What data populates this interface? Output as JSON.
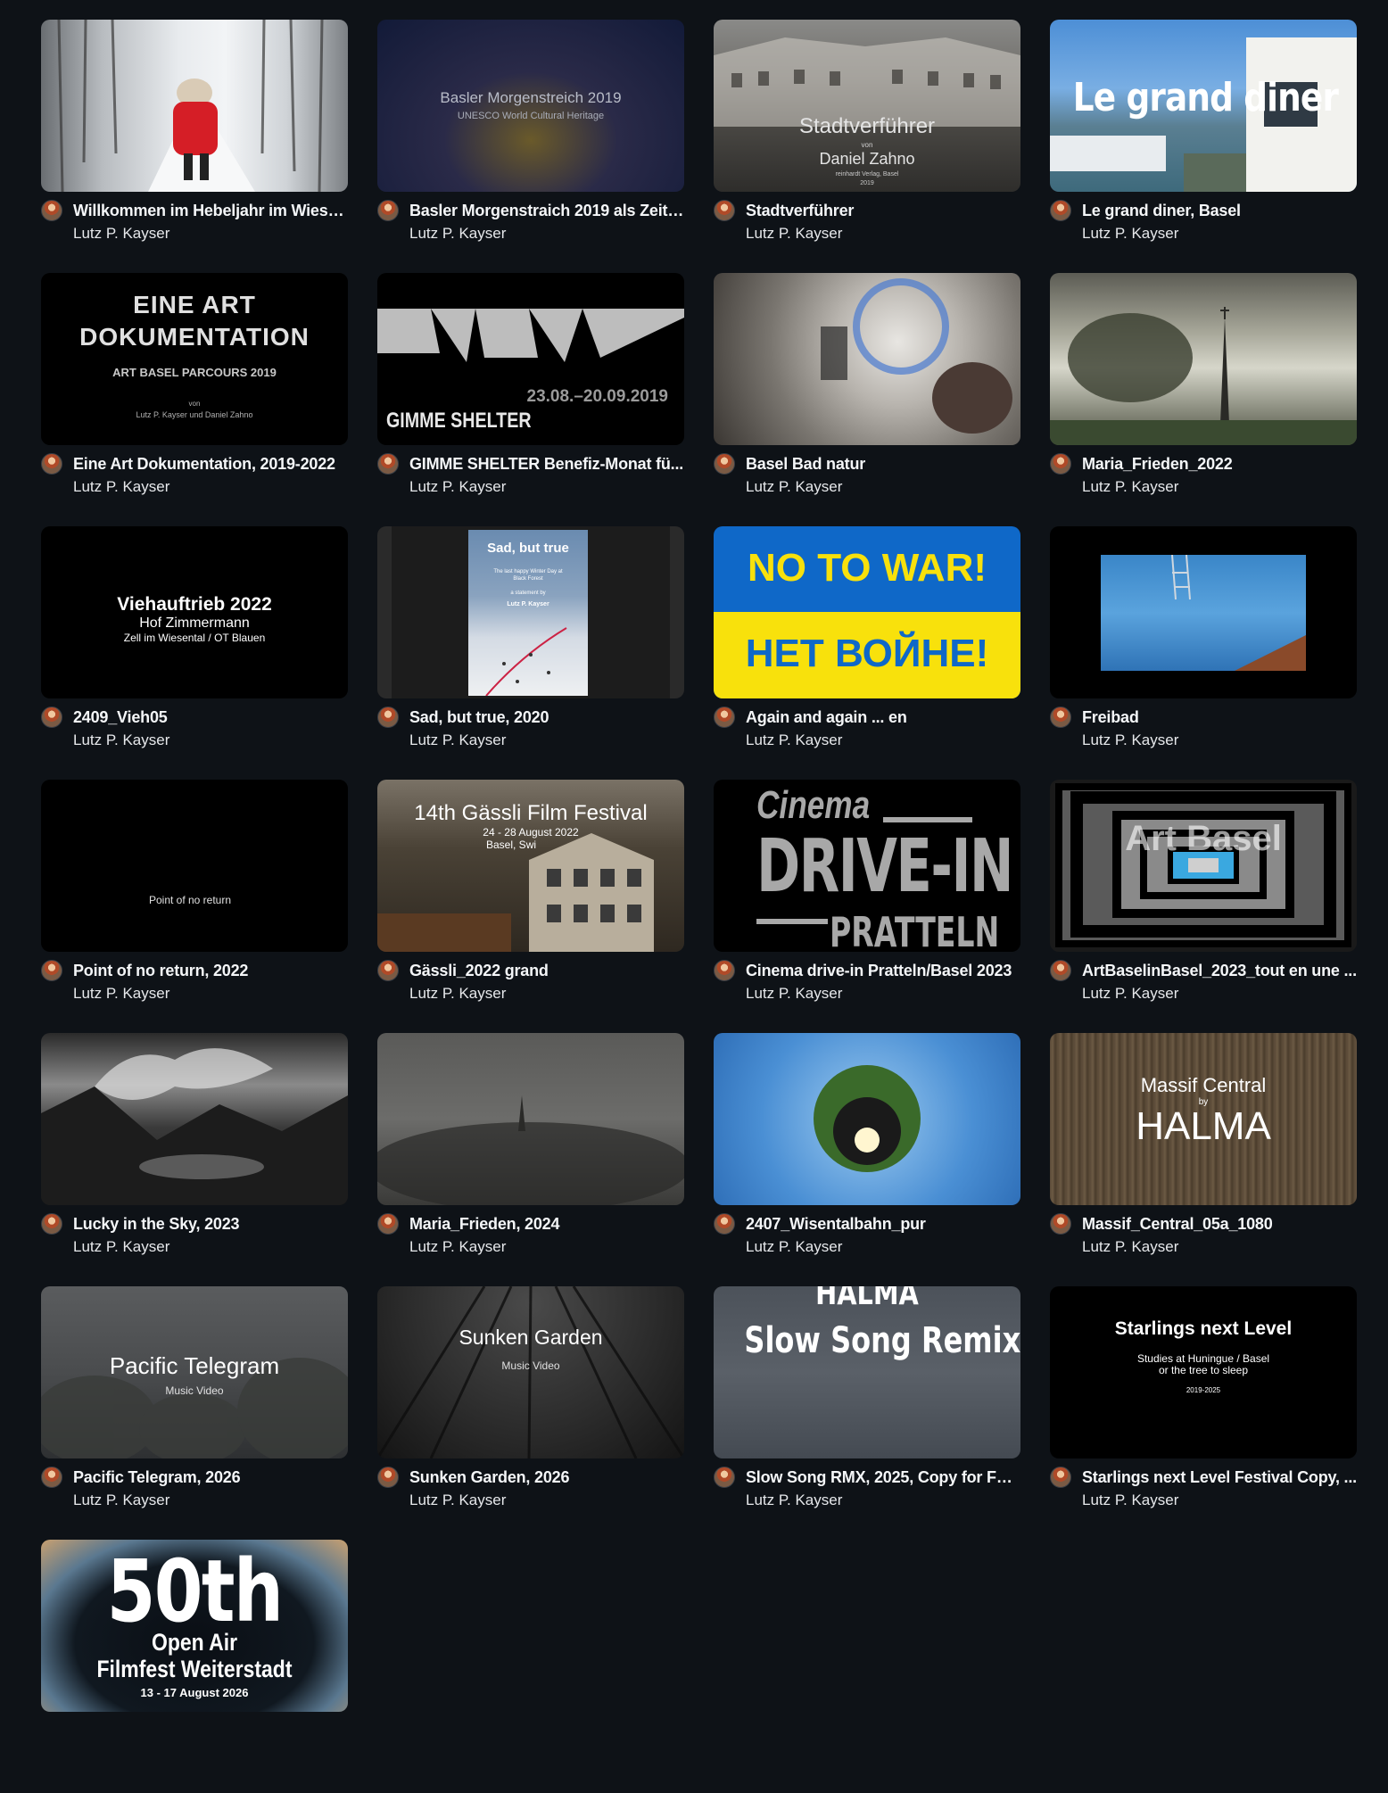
{
  "author_name": "Lutz P. Kayser",
  "videos": [
    {
      "title": "Willkommen im Hebeljahr im Wiese...",
      "author": "Lutz P. Kayser",
      "overlay": {}
    },
    {
      "title": "Basler Morgenstraich 2019 als Zeitr...",
      "author": "Lutz P. Kayser",
      "overlay": {
        "line1": "Basler Morgenstreich 2019",
        "line2": "UNESCO World Cultural Heritage"
      }
    },
    {
      "title": "Stadtverführer",
      "author": "Lutz P. Kayser",
      "overlay": {
        "line1": "Stadtverführer",
        "line2": "von",
        "line3": "Daniel Zahno",
        "line4": "reinhardt Verlag, Basel",
        "line5": "2019"
      }
    },
    {
      "title": "Le grand diner, Basel",
      "author": "Lutz P. Kayser",
      "overlay": {
        "line1": "Le grand diner"
      }
    },
    {
      "title": "Eine Art Dokumentation, 2019-2022",
      "author": "Lutz P. Kayser",
      "overlay": {
        "line1": "EINE ART",
        "line2": "DOKUMENTATION",
        "line3": "ART BASEL PARCOURS 2019",
        "line4": "von",
        "line5": "Lutz P. Kayser und Daniel Zahno"
      }
    },
    {
      "title": "GIMME SHELTER Benefiz-Monat fü...",
      "author": "Lutz P. Kayser",
      "overlay": {
        "line1": "23.08.–20.09.2019",
        "line2": "GIMME SHELTER"
      }
    },
    {
      "title": "Basel Bad natur",
      "author": "Lutz P. Kayser",
      "overlay": {}
    },
    {
      "title": "Maria_Frieden_2022",
      "author": "Lutz P. Kayser",
      "overlay": {}
    },
    {
      "title": "2409_Vieh05",
      "author": "Lutz P. Kayser",
      "overlay": {
        "line1": "Viehauftrieb 2022",
        "line2": "Hof Zimmermann",
        "line3": "Zell im Wiesental / OT Blauen"
      }
    },
    {
      "title": "Sad, but true, 2020",
      "author": "Lutz P. Kayser",
      "overlay": {
        "line1": "Sad, but true",
        "line2": "The last happy Winter Day at",
        "line3": "Black Forest",
        "line4": "a statement by",
        "line5": "Lutz P. Kayser"
      }
    },
    {
      "title": "Again and again ... en",
      "author": "Lutz P. Kayser",
      "overlay": {
        "line1": "NO TO WAR!",
        "line2": "НЕТ ВОЙНЕ!"
      }
    },
    {
      "title": "Freibad",
      "author": "Lutz P. Kayser",
      "overlay": {}
    },
    {
      "title": "Point of no return, 2022",
      "author": "Lutz P. Kayser",
      "overlay": {
        "line1": "Point of no return"
      }
    },
    {
      "title": "Gässli_2022 grand",
      "author": "Lutz P. Kayser",
      "overlay": {
        "line1": "14th Gässli Film Festival",
        "line2": "24 - 28 August 2022",
        "line3": "Basel, Swi"
      }
    },
    {
      "title": "Cinema drive-in Pratteln/Basel 2023",
      "author": "Lutz P. Kayser",
      "overlay": {
        "line1": "Cinema",
        "line2": "DRIVE-IN",
        "line3": "PRATTELN"
      }
    },
    {
      "title": "ArtBaselinBasel_2023_tout en une ...",
      "author": "Lutz P. Kayser",
      "overlay": {
        "line1": "Art Basel"
      }
    },
    {
      "title": "Lucky in the Sky, 2023",
      "author": "Lutz P. Kayser",
      "overlay": {}
    },
    {
      "title": "Maria_Frieden, 2024",
      "author": "Lutz P. Kayser",
      "overlay": {}
    },
    {
      "title": "2407_Wisentalbahn_pur",
      "author": "Lutz P. Kayser",
      "overlay": {}
    },
    {
      "title": "Massif_Central_05a_1080",
      "author": "Lutz P. Kayser",
      "overlay": {
        "line1": "Massif Central",
        "line2": "by",
        "line3": "HALMA"
      }
    },
    {
      "title": "Pacific Telegram, 2026",
      "author": "Lutz P. Kayser",
      "overlay": {
        "line1": "Pacific Telegram",
        "line2": "Music Video"
      }
    },
    {
      "title": "Sunken Garden, 2026",
      "author": "Lutz P. Kayser",
      "overlay": {
        "line1": "Sunken Garden",
        "line2": "Music Video"
      }
    },
    {
      "title": "Slow Song RMX, 2025, Copy for Fes...",
      "author": "Lutz P. Kayser",
      "overlay": {
        "line1": "HALMA",
        "line2": "Slow Song Remix"
      }
    },
    {
      "title": "Starlings next Level Festival Copy, ...",
      "author": "Lutz P. Kayser",
      "overlay": {
        "line1": "Starlings next Level",
        "line2": "Studies at Huningue / Basel",
        "line3": "or the tree to sleep",
        "line4": "2019-2025"
      }
    },
    {
      "title": "50th Open Air Filmfest Weiterstadt",
      "author": "Lutz P. Kayser",
      "overlay": {
        "line1": "50th",
        "line2": "Open Air",
        "line3": "Filmfest Weiterstadt",
        "line4": "13 - 17 August 2026"
      }
    }
  ]
}
